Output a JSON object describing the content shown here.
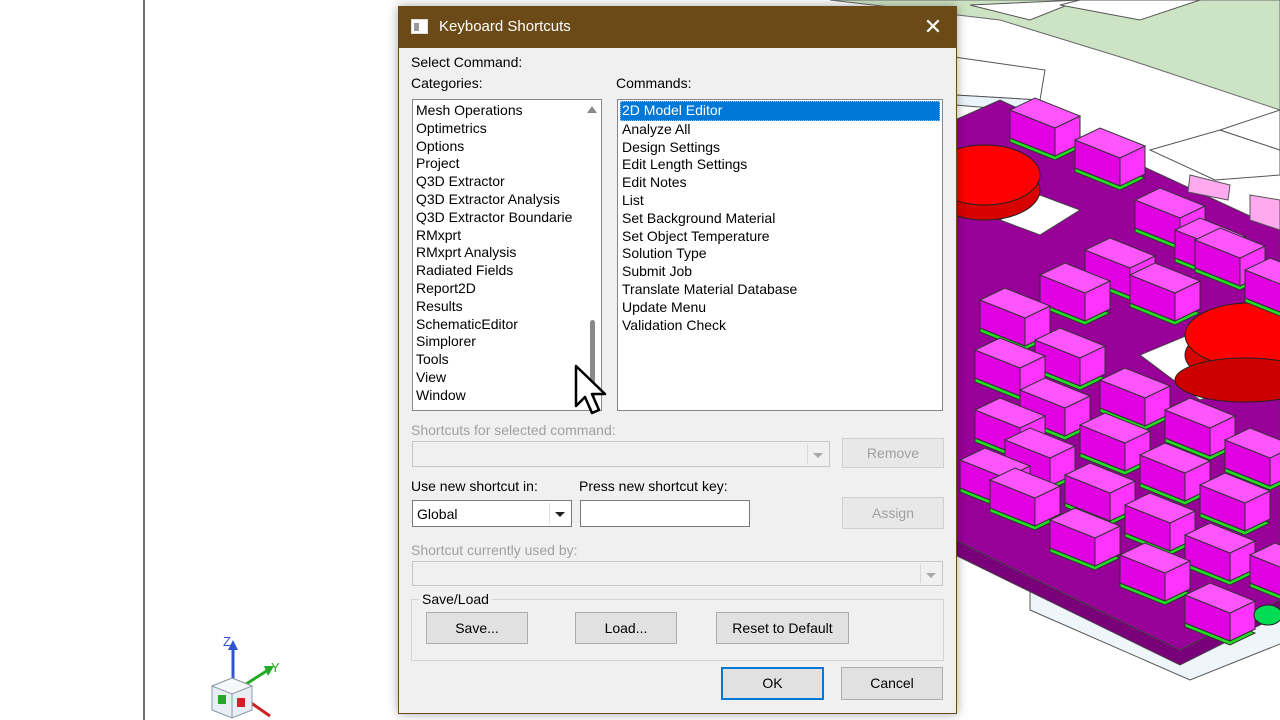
{
  "dialog": {
    "title": "Keyboard Shortcuts",
    "close_glyph": "✕",
    "select_command_label": "Select Command:",
    "categories_label": "Categories:",
    "commands_label": "Commands:",
    "categories": [
      "Mesh Operations",
      "Optimetrics",
      "Options",
      "Project",
      "Q3D Extractor",
      "Q3D Extractor Analysis",
      "Q3D Extractor Boundarie",
      "RMxprt",
      "RMxprt Analysis",
      "Radiated Fields",
      "Report2D",
      "Results",
      "SchematicEditor",
      "Simplorer",
      "Tools",
      "View",
      "Window"
    ],
    "commands": [
      "2D Model Editor",
      "Analyze All",
      "Design Settings",
      "Edit Length Settings",
      "Edit Notes",
      "List",
      "Set Background Material",
      "Set Object Temperature",
      "Solution Type",
      "Submit Job",
      "Translate Material Database",
      "Update Menu",
      "Validation Check"
    ],
    "selected_command": "2D Model Editor",
    "shortcuts_label": "Shortcuts for selected command:",
    "shortcuts_value": "",
    "remove_label": "Remove",
    "use_new_shortcut_label": "Use new shortcut in:",
    "scope_value": "Global",
    "press_key_label": "Press new shortcut key:",
    "press_key_value": "",
    "assign_label": "Assign",
    "currently_used_label": "Shortcut currently used by:",
    "currently_used_value": "",
    "saveload_label": "Save/Load",
    "save_label": "Save...",
    "load_label": "Load...",
    "reset_label": "Reset to Default",
    "ok_label": "OK",
    "cancel_label": "Cancel"
  },
  "axis_triad": {
    "z": "Z",
    "y": "Y"
  },
  "colors": {
    "titlebar": "#6b4a17",
    "selection": "#0078d7",
    "board": "#990099",
    "component": "#ff00ff",
    "pad": "#22dd22",
    "cap": "#ff0000"
  }
}
